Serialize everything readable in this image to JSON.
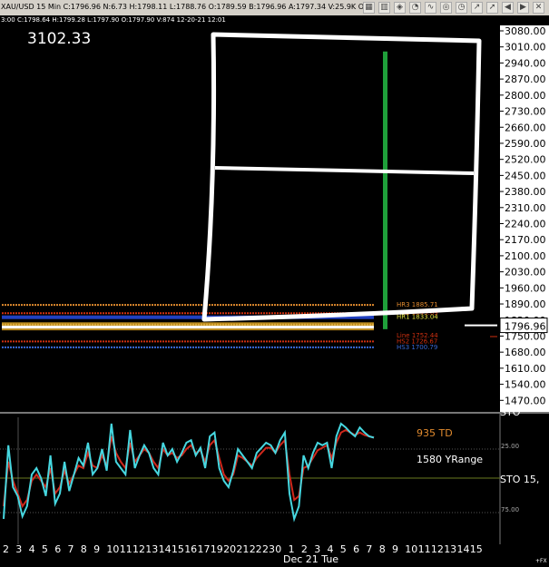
{
  "header": {
    "quote": "XAU/USD 15 Min C:1796.96 N:6.73 H:1798.11 L:1788.76 O:1789.59 B:1796.96 A:1797.34 V:25.9K OI:",
    "sub": "3:00 C:1798.64 H:1799.28 L:1797.90 O:1797.90 V:874 12-20-21 12:01"
  },
  "big_value": "3102.33",
  "current_price_label": "1796.96",
  "indicator": {
    "label_td": "935 TD",
    "label_yrange": "1580 YRange",
    "sto_label": "STO 15,",
    "sto_top_label": "STO",
    "level_25": "25.00",
    "level_75": "75.00"
  },
  "date_label": "Dec 21 Tue",
  "corner_mark": "+FX",
  "levels": [
    {
      "label": "HR3 1885.71",
      "value": 1885.71,
      "color": "#e08a2e"
    },
    {
      "label": "HR2 1849.69",
      "value": 1849.69,
      "color": "#d03010"
    },
    {
      "label": "HR1 1833.04",
      "value": 1833.04,
      "color": "#e0e040"
    },
    {
      "label": "HS2 1726.67",
      "value": 1726.67,
      "color": "#d03010"
    },
    {
      "label": "HS3 1700.79",
      "value": 1700.79,
      "color": "#3a6ad8"
    },
    {
      "label": "Line 1752.44",
      "value": 1752.44,
      "color": "#d03010"
    }
  ],
  "colors": {
    "price_bar": "#1fa03a",
    "stoch_fast": "#46d7e0",
    "stoch_slow": "#d0281c",
    "axis_bg": "#ffffff",
    "level_grid": "#6a7a20"
  },
  "icons": [
    "chart-icon",
    "bars-icon",
    "layers-icon",
    "pie-icon",
    "wave-icon",
    "ring-icon",
    "clock-icon",
    "trend-icon",
    "arrow-icon",
    "chevron-left-icon",
    "chevron-right-icon",
    "close-icon"
  ],
  "chart_data": {
    "type": "line",
    "title": "",
    "ylim": [
      1400,
      3080
    ],
    "y_ticks": [
      1400.0,
      1470.0,
      1540.0,
      1610.0,
      1680.0,
      1750.0,
      1820.0,
      1890.0,
      1960.0,
      2030.0,
      2100.0,
      2170.0,
      2240.0,
      2310.0,
      2380.0,
      2450.0,
      2520.0,
      2590.0,
      2660.0,
      2730.0,
      2800.0,
      2870.0,
      2940.0,
      3010.0,
      3080.0
    ],
    "x_ticks": [
      "2",
      "3",
      "4",
      "5",
      "6",
      "7",
      "8",
      "9",
      "10",
      "11",
      "12",
      "13",
      "14",
      "15",
      "16",
      "17",
      "19",
      "20",
      "21",
      "22",
      "23",
      "0",
      "1",
      "2",
      "3",
      "4",
      "5",
      "6",
      "7",
      "8",
      "9",
      "10",
      "11",
      "12",
      "13",
      "14",
      "15"
    ],
    "series": [
      {
        "name": "",
        "values": [
          1788,
          1789,
          1790,
          1790,
          1791,
          1792,
          1791,
          1790,
          1791,
          1792,
          1792,
          1791,
          1790,
          1789,
          1789,
          1789,
          1790,
          1791,
          1792,
          1793,
          1793,
          1794,
          1795,
          1794,
          1795,
          1796,
          1796,
          1797,
          1797
        ]
      }
    ],
    "spike": {
      "high": 2990,
      "low": 1780
    },
    "stochastic": {
      "ylim": [
        0,
        100
      ],
      "fast": [
        20,
        78,
        45,
        38,
        22,
        30,
        55,
        60,
        52,
        38,
        70,
        32,
        40,
        65,
        42,
        55,
        68,
        62,
        80,
        55,
        60,
        75,
        58,
        95,
        65,
        60,
        55,
        90,
        60,
        70,
        78,
        72,
        60,
        55,
        80,
        70,
        75,
        65,
        72,
        80,
        82,
        70,
        76,
        60,
        85,
        88,
        60,
        50,
        45,
        58,
        75,
        70,
        65,
        60,
        72,
        76,
        80,
        78,
        72,
        82,
        88,
        40,
        20,
        30,
        70,
        60,
        72,
        80,
        78,
        80,
        60,
        85,
        95,
        92,
        88,
        85,
        92,
        88,
        85,
        84
      ],
      "slow": [
        30,
        65,
        50,
        40,
        30,
        35,
        50,
        55,
        50,
        45,
        60,
        40,
        45,
        58,
        48,
        55,
        62,
        60,
        72,
        62,
        60,
        70,
        62,
        85,
        72,
        65,
        60,
        80,
        65,
        70,
        75,
        72,
        65,
        60,
        75,
        70,
        72,
        68,
        70,
        75,
        78,
        72,
        74,
        65,
        78,
        82,
        68,
        55,
        50,
        55,
        70,
        68,
        65,
        62,
        68,
        72,
        76,
        76,
        72,
        78,
        82,
        55,
        35,
        38,
        60,
        62,
        68,
        74,
        76,
        78,
        68,
        80,
        88,
        90,
        88,
        86,
        88,
        86,
        85,
        84
      ]
    },
    "grid": false,
    "legend": "none"
  }
}
